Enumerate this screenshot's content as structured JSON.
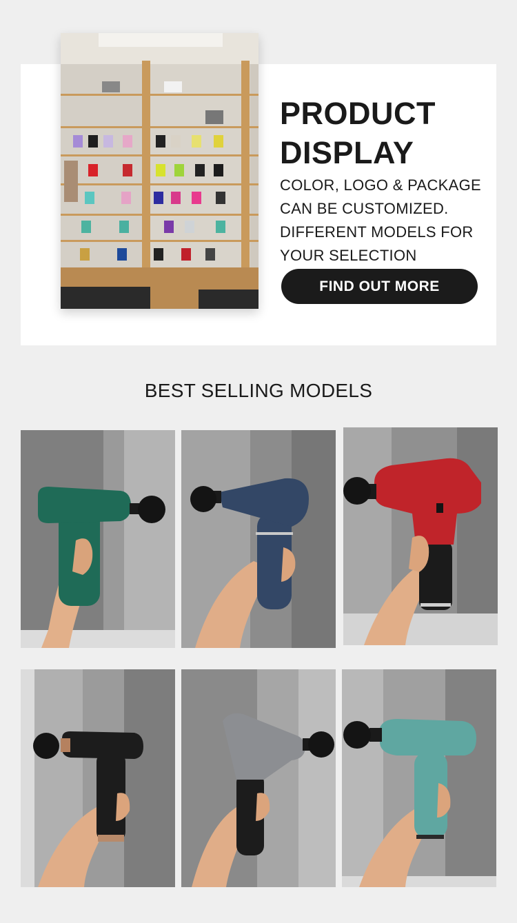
{
  "display": {
    "title_line1": "PRODUCT",
    "title_line2": "DISPLAY",
    "desc_lines": [
      "COLOR, LOGO & PACKAGE",
      "CAN BE CUSTOMIZED.",
      "DIFFERENT MODELS FOR",
      "YOUR SELECTION"
    ],
    "cta_label": "FIND OUT MORE"
  },
  "best_selling": {
    "heading": "BEST SELLING MODELS",
    "products": [
      {
        "color": "green",
        "hex": "#1f6b57"
      },
      {
        "color": "navy",
        "hex": "#334766"
      },
      {
        "color": "red",
        "hex": "#c0242a"
      },
      {
        "color": "black",
        "hex": "#1c1c1c"
      },
      {
        "color": "silver",
        "hex": "#8c8e92"
      },
      {
        "color": "mint",
        "hex": "#5fa7a1"
      }
    ]
  },
  "colors": {
    "page_bg": "#efefef",
    "panel_bg": "#ffffff",
    "button_bg": "#1b1b1b",
    "text": "#1a1a1a"
  }
}
